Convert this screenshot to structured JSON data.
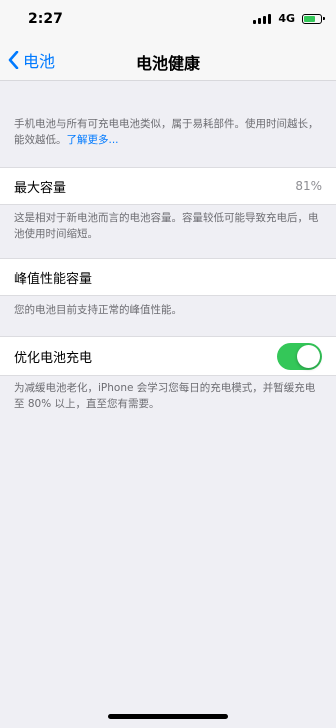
{
  "status": {
    "time": "2:27",
    "network": "4G",
    "battery_fill": 0.7
  },
  "nav": {
    "back_label": "电池",
    "title": "电池健康"
  },
  "intro": {
    "text": "手机电池与所有可充电电池类似，属于易耗部件。使用时间越长，能效越低。",
    "link": "了解更多..."
  },
  "capacity": {
    "label": "最大容量",
    "value": "81%",
    "footer": "这是相对于新电池而言的电池容量。容量较低可能导致充电后，电池使用时间缩短。"
  },
  "peak": {
    "label": "峰值性能容量",
    "footer": "您的电池目前支持正常的峰值性能。"
  },
  "optimized": {
    "label": "优化电池充电",
    "on": true,
    "footer": "为减缓电池老化，iPhone 会学习您每日的充电模式，并暂缓充电至 80% 以上，直至您有需要。"
  },
  "colors": {
    "accent": "#007aff",
    "toggle_on": "#34c759",
    "background": "#efeff4"
  }
}
